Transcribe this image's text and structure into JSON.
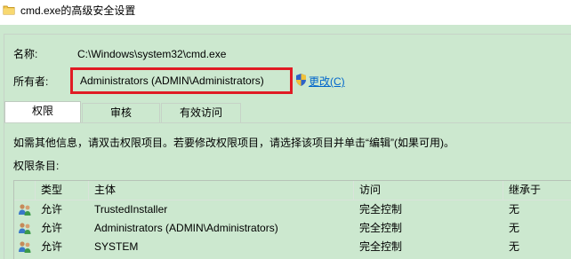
{
  "window": {
    "title": "cmd.exe的高级安全设置"
  },
  "name_row": {
    "label": "名称:",
    "value": "C:\\Windows\\system32\\cmd.exe"
  },
  "owner_row": {
    "label": "所有者:",
    "value": "Administrators (ADMIN\\Administrators)",
    "change_link": "更改(C)"
  },
  "tabs": [
    {
      "label": "权限"
    },
    {
      "label": "审核"
    },
    {
      "label": "有效访问"
    }
  ],
  "info_text": "如需其他信息，请双击权限项目。若要修改权限项目，请选择该项目并单击“编辑”(如果可用)。",
  "entries_label": "权限条目:",
  "table": {
    "headers": [
      "类型",
      "主体",
      "访问",
      "继承于"
    ],
    "rows": [
      {
        "type": "允许",
        "principal": "TrustedInstaller",
        "access": "完全控制",
        "inherited": "无"
      },
      {
        "type": "允许",
        "principal": "Administrators (ADMIN\\Administrators)",
        "access": "完全控制",
        "inherited": "无"
      },
      {
        "type": "允许",
        "principal": "SYSTEM",
        "access": "完全控制",
        "inherited": "无"
      }
    ]
  },
  "icons": {
    "title": "folder-icon",
    "change": "uac-shield-icon",
    "row": "user-group-icon"
  },
  "colors": {
    "background": "#cce8cf",
    "highlight_border": "#e01b24",
    "link": "#0066cc"
  }
}
